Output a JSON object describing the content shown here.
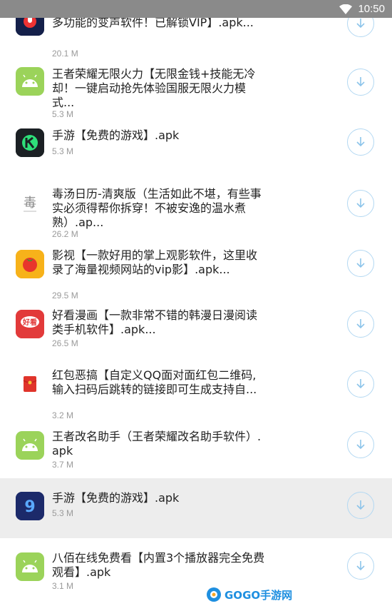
{
  "status_bar": {
    "time": "10:50",
    "wifi_icon": "wifi-icon",
    "bg": "#8a8a8a"
  },
  "apps": [
    {
      "title": "多功能的变声软件！已解锁VIP】.apk...",
      "title_top_partial": "",
      "size": "20.1 M",
      "icon": "voice-changer-icon"
    },
    {
      "title": "王者荣耀无限火力【无限金钱+技能无冷却！一键启动抢先体验国服无限火力模式...",
      "size": "5.3 M",
      "icon": "android-icon"
    },
    {
      "title": "手游【免费的游戏】.apk",
      "size": "5.3 M",
      "icon": "k-logo-icon"
    },
    {
      "title": "毒汤日历-清爽版（生活如此不堪，有些事实必须得帮你拆穿！不被安逸的温水煮熟）.ap...",
      "size": "26.2 M",
      "icon": "calendar-icon"
    },
    {
      "title": "影视【一款好用的掌上观影软件，这里收录了海量视频网站的vip影】.apk...",
      "size": "29.5 M",
      "icon": "tomato-icon"
    },
    {
      "title": "好看漫画【一款非常不错的韩漫日漫阅读类手机软件】.apk...",
      "size": "26.5 M",
      "icon": "comic-icon"
    },
    {
      "title": "红包恶搞【自定义QQ面对面红包二维码,输入扫码后跳转的链接即可生成支持自...",
      "size": "3.2 M",
      "icon": "red-envelope-icon"
    },
    {
      "title": "王者改名助手（王者荣耀改名助手软件）.apk",
      "size": "3.7 M",
      "icon": "android-icon"
    },
    {
      "title": "手游【免费的游戏】.apk",
      "size": "5.3 M",
      "icon": "nine-logo-icon"
    },
    {
      "title": "八佰在线免费看【内置3个播放器完全免费观看】.apk",
      "size": "3.1 M",
      "icon": "android-icon"
    }
  ],
  "watermark": {
    "text": "GOGO手游网",
    "icon": "gogo-logo-icon"
  },
  "colors": {
    "accent": "#b3d8f2",
    "highlight": "#ededed",
    "android": "#9bd35a"
  }
}
